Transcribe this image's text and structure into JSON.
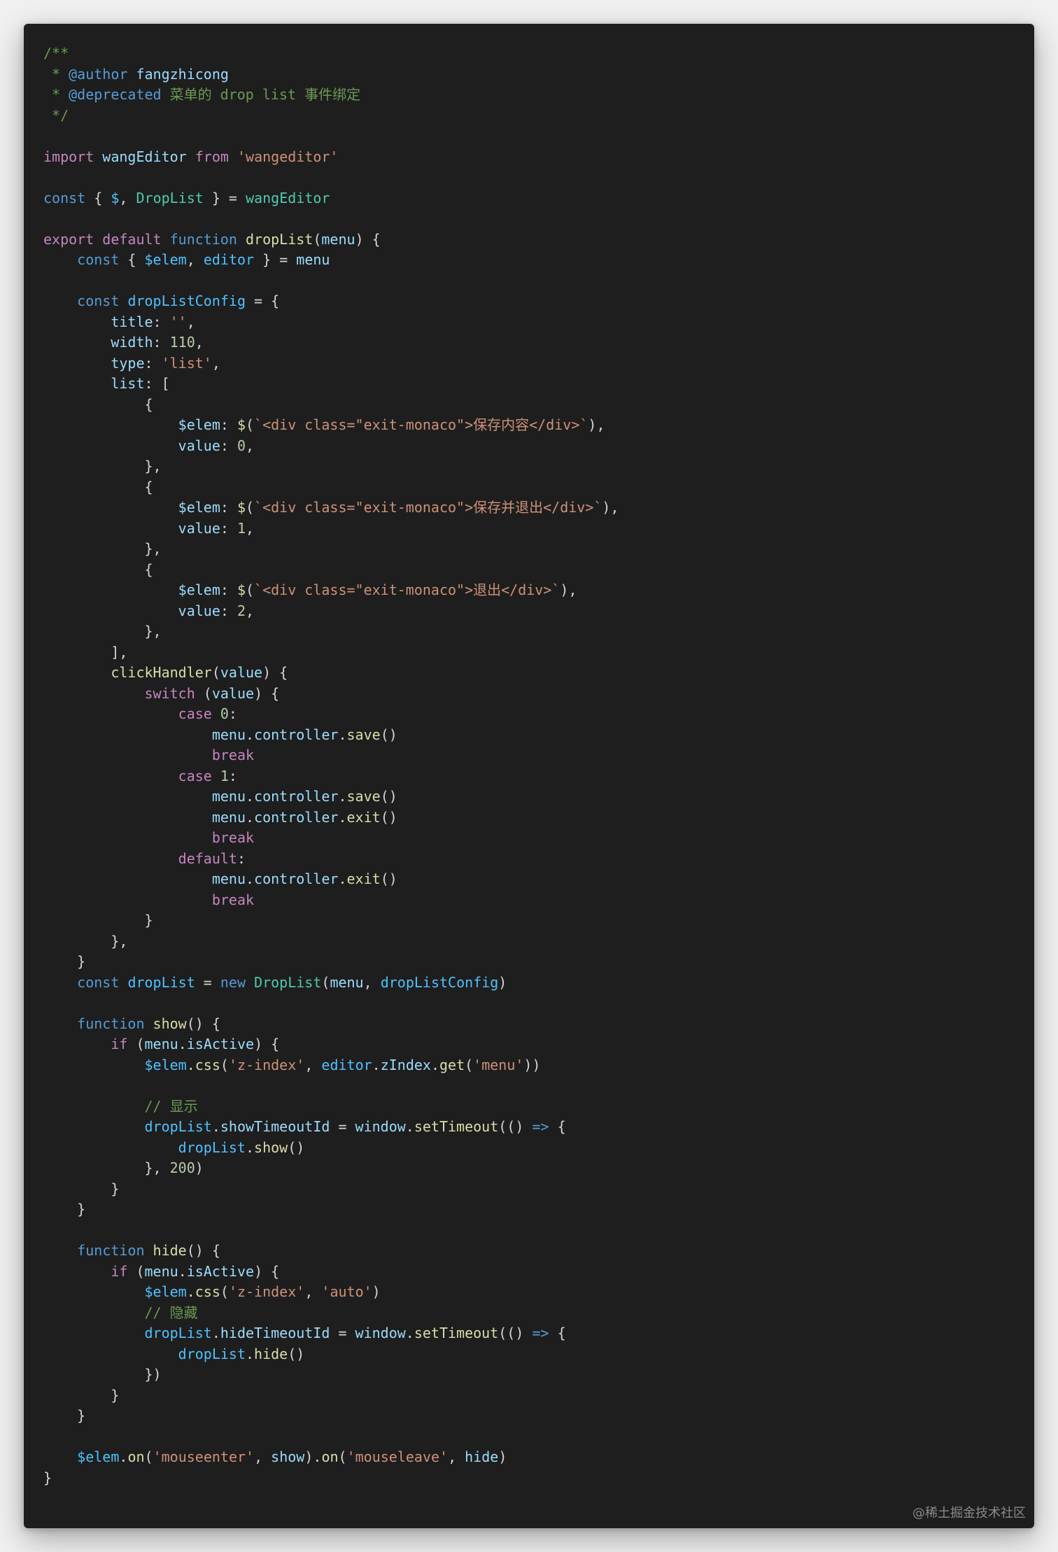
{
  "watermark": "@稀土掘金技术社区",
  "theme": {
    "background": "#1e1e1e",
    "keyword": "#569cd6",
    "control": "#c586c0",
    "function": "#dcdcaa",
    "variable": "#9cdcfe",
    "constant": "#4fc1ff",
    "class": "#4ec9b0",
    "string": "#ce9178",
    "number": "#b5cea8",
    "comment": "#6a9955",
    "plain": "#d4d4d4"
  },
  "code_lines": [
    [
      [
        "com",
        "/**"
      ]
    ],
    [
      [
        "com",
        " * "
      ],
      [
        "tag",
        "@author"
      ],
      [
        "var",
        " fangzhicong"
      ]
    ],
    [
      [
        "com",
        " * "
      ],
      [
        "tag",
        "@deprecated"
      ],
      [
        "com",
        " 菜单的 drop list 事件绑定"
      ]
    ],
    [
      [
        "com",
        " */"
      ]
    ],
    [],
    [
      [
        "ctl",
        "import"
      ],
      [
        "pun",
        " "
      ],
      [
        "var",
        "wangEditor"
      ],
      [
        "pun",
        " "
      ],
      [
        "ctl",
        "from"
      ],
      [
        "pun",
        " "
      ],
      [
        "str",
        "'wangeditor'"
      ]
    ],
    [],
    [
      [
        "kw",
        "const"
      ],
      [
        "pun",
        " { "
      ],
      [
        "cst",
        "$"
      ],
      [
        "pun",
        ", "
      ],
      [
        "cls",
        "DropList"
      ],
      [
        "pun",
        " } = "
      ],
      [
        "cls",
        "wangEditor"
      ]
    ],
    [],
    [
      [
        "ctl",
        "export"
      ],
      [
        "pun",
        " "
      ],
      [
        "ctl",
        "default"
      ],
      [
        "pun",
        " "
      ],
      [
        "kw",
        "function"
      ],
      [
        "pun",
        " "
      ],
      [
        "fn",
        "dropList"
      ],
      [
        "pun",
        "("
      ],
      [
        "var",
        "menu"
      ],
      [
        "pun",
        ") {"
      ]
    ],
    [
      [
        "pun",
        "    "
      ],
      [
        "kw",
        "const"
      ],
      [
        "pun",
        " { "
      ],
      [
        "cst",
        "$elem"
      ],
      [
        "pun",
        ", "
      ],
      [
        "cst",
        "editor"
      ],
      [
        "pun",
        " } = "
      ],
      [
        "var",
        "menu"
      ]
    ],
    [],
    [
      [
        "pun",
        "    "
      ],
      [
        "kw",
        "const"
      ],
      [
        "pun",
        " "
      ],
      [
        "cst",
        "dropListConfig"
      ],
      [
        "pun",
        " = {"
      ]
    ],
    [
      [
        "pun",
        "        "
      ],
      [
        "var",
        "title"
      ],
      [
        "pun",
        ": "
      ],
      [
        "str",
        "''"
      ],
      [
        "pun",
        ","
      ]
    ],
    [
      [
        "pun",
        "        "
      ],
      [
        "var",
        "width"
      ],
      [
        "pun",
        ": "
      ],
      [
        "num",
        "110"
      ],
      [
        "pun",
        ","
      ]
    ],
    [
      [
        "pun",
        "        "
      ],
      [
        "var",
        "type"
      ],
      [
        "pun",
        ": "
      ],
      [
        "str",
        "'list'"
      ],
      [
        "pun",
        ","
      ]
    ],
    [
      [
        "pun",
        "        "
      ],
      [
        "var",
        "list"
      ],
      [
        "pun",
        ": ["
      ]
    ],
    [
      [
        "pun",
        "            {"
      ]
    ],
    [
      [
        "pun",
        "                "
      ],
      [
        "var",
        "$elem"
      ],
      [
        "pun",
        ": "
      ],
      [
        "fn",
        "$"
      ],
      [
        "pun",
        "("
      ],
      [
        "str",
        "`<div class=\"exit-monaco\">保存内容</div>`"
      ],
      [
        "pun",
        "),"
      ]
    ],
    [
      [
        "pun",
        "                "
      ],
      [
        "var",
        "value"
      ],
      [
        "pun",
        ": "
      ],
      [
        "num",
        "0"
      ],
      [
        "pun",
        ","
      ]
    ],
    [
      [
        "pun",
        "            },"
      ]
    ],
    [
      [
        "pun",
        "            {"
      ]
    ],
    [
      [
        "pun",
        "                "
      ],
      [
        "var",
        "$elem"
      ],
      [
        "pun",
        ": "
      ],
      [
        "fn",
        "$"
      ],
      [
        "pun",
        "("
      ],
      [
        "str",
        "`<div class=\"exit-monaco\">保存并退出</div>`"
      ],
      [
        "pun",
        "),"
      ]
    ],
    [
      [
        "pun",
        "                "
      ],
      [
        "var",
        "value"
      ],
      [
        "pun",
        ": "
      ],
      [
        "num",
        "1"
      ],
      [
        "pun",
        ","
      ]
    ],
    [
      [
        "pun",
        "            },"
      ]
    ],
    [
      [
        "pun",
        "            {"
      ]
    ],
    [
      [
        "pun",
        "                "
      ],
      [
        "var",
        "$elem"
      ],
      [
        "pun",
        ": "
      ],
      [
        "fn",
        "$"
      ],
      [
        "pun",
        "("
      ],
      [
        "str",
        "`<div class=\"exit-monaco\">退出</div>`"
      ],
      [
        "pun",
        "),"
      ]
    ],
    [
      [
        "pun",
        "                "
      ],
      [
        "var",
        "value"
      ],
      [
        "pun",
        ": "
      ],
      [
        "num",
        "2"
      ],
      [
        "pun",
        ","
      ]
    ],
    [
      [
        "pun",
        "            },"
      ]
    ],
    [
      [
        "pun",
        "        ],"
      ]
    ],
    [
      [
        "pun",
        "        "
      ],
      [
        "fn",
        "clickHandler"
      ],
      [
        "pun",
        "("
      ],
      [
        "var",
        "value"
      ],
      [
        "pun",
        ") {"
      ]
    ],
    [
      [
        "pun",
        "            "
      ],
      [
        "ctl",
        "switch"
      ],
      [
        "pun",
        " ("
      ],
      [
        "var",
        "value"
      ],
      [
        "pun",
        ") {"
      ]
    ],
    [
      [
        "pun",
        "                "
      ],
      [
        "ctl",
        "case"
      ],
      [
        "pun",
        " "
      ],
      [
        "num",
        "0"
      ],
      [
        "pun",
        ":"
      ]
    ],
    [
      [
        "pun",
        "                    "
      ],
      [
        "var",
        "menu"
      ],
      [
        "pun",
        "."
      ],
      [
        "var",
        "controller"
      ],
      [
        "pun",
        "."
      ],
      [
        "fn",
        "save"
      ],
      [
        "pun",
        "()"
      ]
    ],
    [
      [
        "pun",
        "                    "
      ],
      [
        "ctl",
        "break"
      ]
    ],
    [
      [
        "pun",
        "                "
      ],
      [
        "ctl",
        "case"
      ],
      [
        "pun",
        " "
      ],
      [
        "num",
        "1"
      ],
      [
        "pun",
        ":"
      ]
    ],
    [
      [
        "pun",
        "                    "
      ],
      [
        "var",
        "menu"
      ],
      [
        "pun",
        "."
      ],
      [
        "var",
        "controller"
      ],
      [
        "pun",
        "."
      ],
      [
        "fn",
        "save"
      ],
      [
        "pun",
        "()"
      ]
    ],
    [
      [
        "pun",
        "                    "
      ],
      [
        "var",
        "menu"
      ],
      [
        "pun",
        "."
      ],
      [
        "var",
        "controller"
      ],
      [
        "pun",
        "."
      ],
      [
        "fn",
        "exit"
      ],
      [
        "pun",
        "()"
      ]
    ],
    [
      [
        "pun",
        "                    "
      ],
      [
        "ctl",
        "break"
      ]
    ],
    [
      [
        "pun",
        "                "
      ],
      [
        "ctl",
        "default"
      ],
      [
        "pun",
        ":"
      ]
    ],
    [
      [
        "pun",
        "                    "
      ],
      [
        "var",
        "menu"
      ],
      [
        "pun",
        "."
      ],
      [
        "var",
        "controller"
      ],
      [
        "pun",
        "."
      ],
      [
        "fn",
        "exit"
      ],
      [
        "pun",
        "()"
      ]
    ],
    [
      [
        "pun",
        "                    "
      ],
      [
        "ctl",
        "break"
      ]
    ],
    [
      [
        "pun",
        "            }"
      ]
    ],
    [
      [
        "pun",
        "        },"
      ]
    ],
    [
      [
        "pun",
        "    }"
      ]
    ],
    [
      [
        "pun",
        "    "
      ],
      [
        "kw",
        "const"
      ],
      [
        "pun",
        " "
      ],
      [
        "cst",
        "dropList"
      ],
      [
        "pun",
        " = "
      ],
      [
        "kw",
        "new"
      ],
      [
        "pun",
        " "
      ],
      [
        "cls",
        "DropList"
      ],
      [
        "pun",
        "("
      ],
      [
        "var",
        "menu"
      ],
      [
        "pun",
        ", "
      ],
      [
        "cst",
        "dropListConfig"
      ],
      [
        "pun",
        ")"
      ]
    ],
    [],
    [
      [
        "pun",
        "    "
      ],
      [
        "kw",
        "function"
      ],
      [
        "pun",
        " "
      ],
      [
        "fn",
        "show"
      ],
      [
        "pun",
        "() {"
      ]
    ],
    [
      [
        "pun",
        "        "
      ],
      [
        "ctl",
        "if"
      ],
      [
        "pun",
        " ("
      ],
      [
        "var",
        "menu"
      ],
      [
        "pun",
        "."
      ],
      [
        "var",
        "isActive"
      ],
      [
        "pun",
        ") {"
      ]
    ],
    [
      [
        "pun",
        "            "
      ],
      [
        "cst",
        "$elem"
      ],
      [
        "pun",
        "."
      ],
      [
        "fn",
        "css"
      ],
      [
        "pun",
        "("
      ],
      [
        "str",
        "'z-index'"
      ],
      [
        "pun",
        ", "
      ],
      [
        "cst",
        "editor"
      ],
      [
        "pun",
        "."
      ],
      [
        "var",
        "zIndex"
      ],
      [
        "pun",
        "."
      ],
      [
        "fn",
        "get"
      ],
      [
        "pun",
        "("
      ],
      [
        "str",
        "'menu'"
      ],
      [
        "pun",
        "))"
      ]
    ],
    [],
    [
      [
        "pun",
        "            "
      ],
      [
        "com",
        "// 显示"
      ]
    ],
    [
      [
        "pun",
        "            "
      ],
      [
        "cst",
        "dropList"
      ],
      [
        "pun",
        "."
      ],
      [
        "var",
        "showTimeoutId"
      ],
      [
        "pun",
        " = "
      ],
      [
        "var",
        "window"
      ],
      [
        "pun",
        "."
      ],
      [
        "fn",
        "setTimeout"
      ],
      [
        "pun",
        "(() "
      ],
      [
        "kw",
        "=>"
      ],
      [
        "pun",
        " {"
      ]
    ],
    [
      [
        "pun",
        "                "
      ],
      [
        "cst",
        "dropList"
      ],
      [
        "pun",
        "."
      ],
      [
        "fn",
        "show"
      ],
      [
        "pun",
        "()"
      ]
    ],
    [
      [
        "pun",
        "            }, "
      ],
      [
        "num",
        "200"
      ],
      [
        "pun",
        ")"
      ]
    ],
    [
      [
        "pun",
        "        }"
      ]
    ],
    [
      [
        "pun",
        "    }"
      ]
    ],
    [],
    [
      [
        "pun",
        "    "
      ],
      [
        "kw",
        "function"
      ],
      [
        "pun",
        " "
      ],
      [
        "fn",
        "hide"
      ],
      [
        "pun",
        "() {"
      ]
    ],
    [
      [
        "pun",
        "        "
      ],
      [
        "ctl",
        "if"
      ],
      [
        "pun",
        " ("
      ],
      [
        "var",
        "menu"
      ],
      [
        "pun",
        "."
      ],
      [
        "var",
        "isActive"
      ],
      [
        "pun",
        ") {"
      ]
    ],
    [
      [
        "pun",
        "            "
      ],
      [
        "cst",
        "$elem"
      ],
      [
        "pun",
        "."
      ],
      [
        "fn",
        "css"
      ],
      [
        "pun",
        "("
      ],
      [
        "str",
        "'z-index'"
      ],
      [
        "pun",
        ", "
      ],
      [
        "str",
        "'auto'"
      ],
      [
        "pun",
        ")"
      ]
    ],
    [
      [
        "pun",
        "            "
      ],
      [
        "com",
        "// 隐藏"
      ]
    ],
    [
      [
        "pun",
        "            "
      ],
      [
        "cst",
        "dropList"
      ],
      [
        "pun",
        "."
      ],
      [
        "var",
        "hideTimeoutId"
      ],
      [
        "pun",
        " = "
      ],
      [
        "var",
        "window"
      ],
      [
        "pun",
        "."
      ],
      [
        "fn",
        "setTimeout"
      ],
      [
        "pun",
        "(() "
      ],
      [
        "kw",
        "=>"
      ],
      [
        "pun",
        " {"
      ]
    ],
    [
      [
        "pun",
        "                "
      ],
      [
        "cst",
        "dropList"
      ],
      [
        "pun",
        "."
      ],
      [
        "fn",
        "hide"
      ],
      [
        "pun",
        "()"
      ]
    ],
    [
      [
        "pun",
        "            })"
      ]
    ],
    [
      [
        "pun",
        "        }"
      ]
    ],
    [
      [
        "pun",
        "    }"
      ]
    ],
    [],
    [
      [
        "pun",
        "    "
      ],
      [
        "cst",
        "$elem"
      ],
      [
        "pun",
        "."
      ],
      [
        "fn",
        "on"
      ],
      [
        "pun",
        "("
      ],
      [
        "str",
        "'mouseenter'"
      ],
      [
        "pun",
        ", "
      ],
      [
        "var",
        "show"
      ],
      [
        "pun",
        ")."
      ],
      [
        "fn",
        "on"
      ],
      [
        "pun",
        "("
      ],
      [
        "str",
        "'mouseleave'"
      ],
      [
        "pun",
        ", "
      ],
      [
        "var",
        "hide"
      ],
      [
        "pun",
        ")"
      ]
    ],
    [
      [
        "pun",
        "}"
      ]
    ]
  ]
}
